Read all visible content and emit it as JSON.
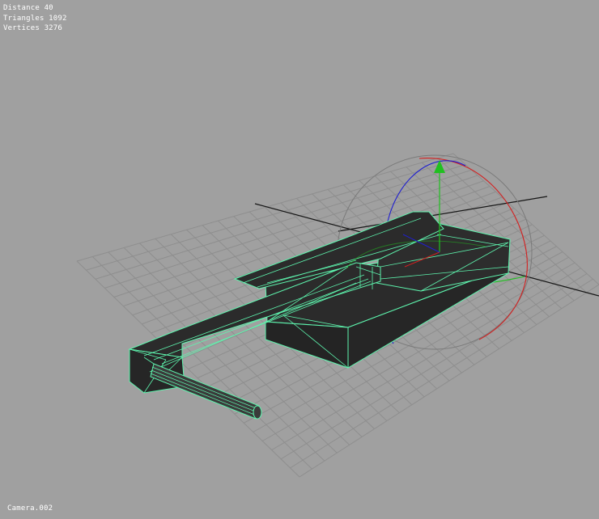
{
  "stats": {
    "distance": "Distance 40",
    "triangles": "Triangles 1092",
    "vertices": "Vertices 3276"
  },
  "camera": {
    "label": "Camera.002"
  },
  "colors": {
    "background": "#a0a0a0",
    "grid": "#8e8e8e",
    "grid_axis": "#151515",
    "wireframe": "#5ef5ae",
    "mesh_fill": "#2b2b2b",
    "gizmo_x": "#d42020",
    "gizmo_y": "#2020d0",
    "gizmo_z": "#20c020",
    "gizmo_outer": "#7a7a7a"
  }
}
